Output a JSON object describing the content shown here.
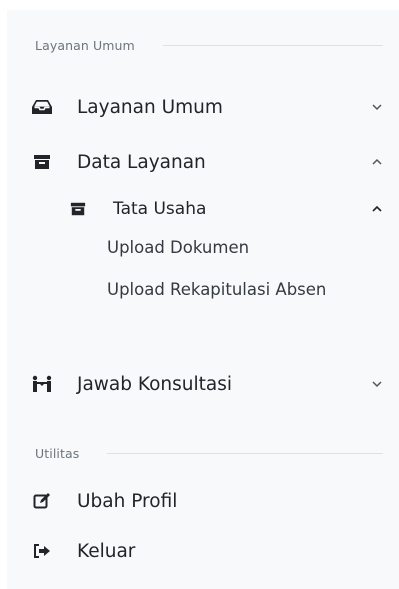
{
  "sidebar": {
    "section1": {
      "title": "Layanan Umum"
    },
    "layanan_umum": {
      "label": "Layanan Umum",
      "icon": "inbox-icon",
      "chevron": "chevron-down-icon"
    },
    "data_layanan": {
      "label": "Data Layanan",
      "icon": "archive-icon",
      "chevron": "chevron-up-icon",
      "tata_usaha": {
        "label": "Tata Usaha",
        "icon": "archive-icon",
        "chevron": "chevron-up-icon",
        "items": [
          {
            "label": "Upload Dokumen"
          },
          {
            "label": "Upload Rekapitulasi Absen"
          }
        ]
      }
    },
    "jawab_konsultasi": {
      "label": "Jawab Konsultasi",
      "icon": "handshake-icon",
      "chevron": "chevron-down-icon"
    },
    "section2": {
      "title": "Utilitas"
    },
    "ubah_profil": {
      "label": "Ubah Profil",
      "icon": "edit-icon"
    },
    "keluar": {
      "label": "Keluar",
      "icon": "sign-out-icon"
    },
    "colors": {
      "text": "#212529",
      "muted": "#6c757d",
      "background": "#f8f9fa"
    }
  }
}
